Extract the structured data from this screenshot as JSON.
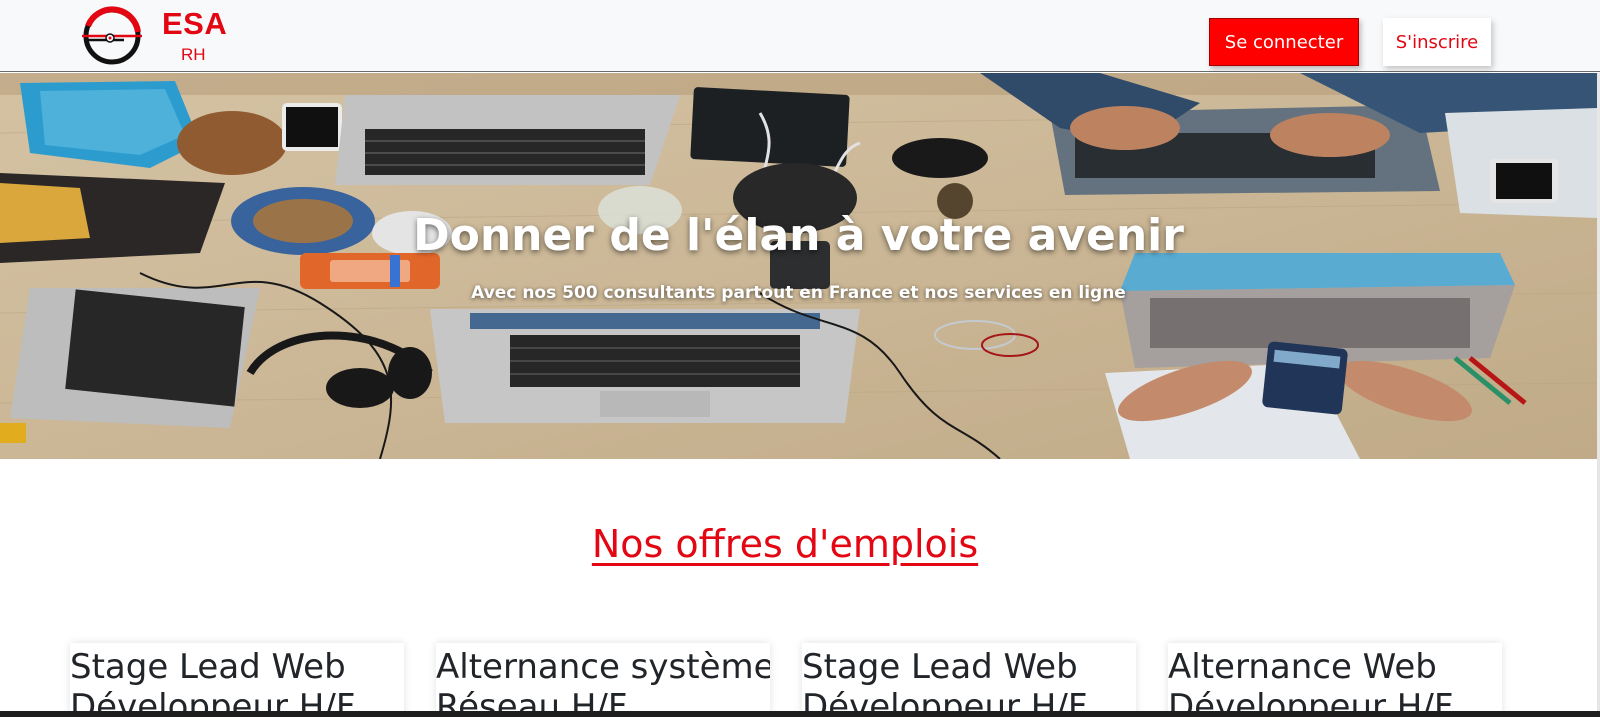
{
  "brand": {
    "name": "ESA",
    "sub": "RH"
  },
  "nav": {
    "login_label": "Se connecter",
    "signup_label": "S'inscrire"
  },
  "hero": {
    "title": "Donner de l'élan à votre avenir",
    "subtitle": "Avec nos 500 consultants partout en France et nos services en ligne"
  },
  "jobs": {
    "section_title": "Nos offres d'emplois",
    "cards": [
      {
        "title": "Stage Lead Web Développeur H/F"
      },
      {
        "title": "Alternance système Réseau H/F"
      },
      {
        "title": "Stage Lead Web Développeur H/F"
      },
      {
        "title": "Alternance Web Développeur H/F"
      }
    ]
  },
  "colors": {
    "accent": "#e30613",
    "button_red": "#ff0000",
    "navbar_bg": "#f8f9fa"
  }
}
